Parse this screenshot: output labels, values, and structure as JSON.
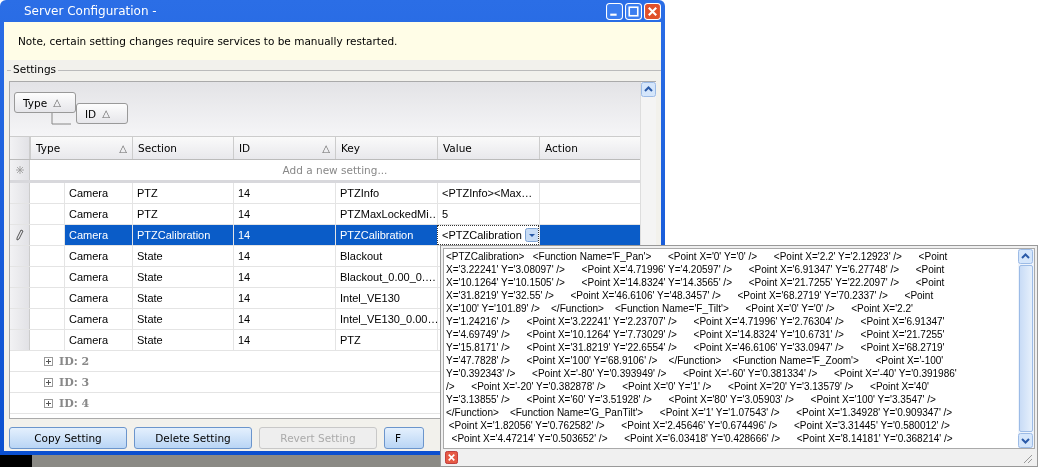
{
  "window": {
    "title": "Server Configuration -"
  },
  "note": "Note, certain setting changes require services to be manually restarted.",
  "settings": {
    "title": "Settings",
    "group_by": [
      {
        "label": "Type",
        "sort": "△"
      },
      {
        "label": "ID",
        "sort": "△"
      }
    ],
    "columns": [
      {
        "label": "Type",
        "sort": "△"
      },
      {
        "label": "Section"
      },
      {
        "label": "ID",
        "sort": "△"
      },
      {
        "label": "Key"
      },
      {
        "label": "Value"
      },
      {
        "label": "Action"
      }
    ],
    "new_row_placeholder": "Add a new setting...",
    "rows": [
      {
        "type": "Camera",
        "section": "PTZ",
        "id": "14",
        "key": "PTZInfo",
        "value": "<PTZInfo><Max…",
        "selected": false,
        "editing": false
      },
      {
        "type": "Camera",
        "section": "PTZ",
        "id": "14",
        "key": "PTZMaxLockedMi…",
        "value": "5",
        "selected": false,
        "editing": false
      },
      {
        "type": "Camera",
        "section": "PTZCalibration",
        "id": "14",
        "key": "PTZCalibration",
        "value": "<PTZCalibration",
        "selected": true,
        "editing": true
      },
      {
        "type": "Camera",
        "section": "State",
        "id": "14",
        "key": "Blackout",
        "selected": false,
        "editing": false
      },
      {
        "type": "Camera",
        "section": "State",
        "id": "14",
        "key": "Blackout_0.00_0.…",
        "selected": false,
        "editing": false
      },
      {
        "type": "Camera",
        "section": "State",
        "id": "14",
        "key": "Intel_VE130",
        "selected": false,
        "editing": false
      },
      {
        "type": "Camera",
        "section": "State",
        "id": "14",
        "key": "Intel_VE130_0.00…",
        "selected": false,
        "editing": false
      },
      {
        "type": "Camera",
        "section": "State",
        "id": "14",
        "key": "PTZ",
        "selected": false,
        "editing": false
      }
    ],
    "groups": [
      {
        "label": "ID: 2",
        "expanded": false
      },
      {
        "label": "ID: 3",
        "expanded": false
      },
      {
        "label": "ID: 4",
        "expanded": false
      }
    ]
  },
  "buttons": [
    {
      "label": "Copy Setting",
      "disabled": false
    },
    {
      "label": "Delete Setting",
      "disabled": false
    },
    {
      "label": "Revert Setting",
      "disabled": true
    },
    {
      "label": "F",
      "disabled": false
    }
  ],
  "value_editor": {
    "lines": [
      "<PTZCalibration>   <Function Name='F_Pan'>      <Point X='0' Y='0' />      <Point X='2.2' Y='2.12923' />      <Point",
      "X='3.22241' Y='3.08097' />      <Point X='4.71996' Y='4.20597' />      <Point X='6.91347' Y='6.27748' />      <Point",
      "X='10.1264' Y='10.1505' />      <Point X='14.8324' Y='14.3565' />      <Point X='21.7255' Y='22.2097' />      <Point",
      "X='31.8219' Y='32.55' />      <Point X='46.6106' Y='48.3457' />      <Point X='68.2719' Y='70.2337' />      <Point",
      "X='100' Y='101.89' />    </Function>    <Function Name='F_Tilt'>      <Point X='0' Y='0' />      <Point X='2.2'",
      "Y='1.24216' />      <Point X='3.22241' Y='2.23707' />      <Point X='4.71996' Y='2.76304' />      <Point X='6.91347'",
      "Y='4.69749' />      <Point X='10.1264' Y='7.73029' />      <Point X='14.8324' Y='10.6731' />      <Point X='21.7255'",
      "Y='15.8171' />      <Point X='31.8219' Y='22.6554' />      <Point X='46.6106' Y='33.0947' />      <Point X='68.2719'",
      "Y='47.7828' />      <Point X='100' Y='68.9106' />    </Function>    <Function Name='F_Zoom'>      <Point X='-100'",
      "Y='0.392343' />      <Point X='-80' Y='0.393949' />      <Point X='-60' Y='0.381334' />      <Point X='-40' Y='0.391986'",
      "/>      <Point X='-20' Y='0.382878' />      <Point X='0' Y='1' />      <Point X='20' Y='3.13579' />      <Point X='40'",
      "Y='3.13855' />      <Point X='60' Y='3.51928' />      <Point X='80' Y='3.05903' />      <Point X='100' Y='3.3547' />",
      "</Function>    <Function Name='G_PanTilt'>      <Point X='1' Y='1.07543' />      <Point X='1.34928' Y='0.909347' />",
      " <Point X='1.82056' Y='0.762582' />      <Point X='2.45646' Y='0.674496' />      <Point X='3.31445' Y='0.580012' />",
      "  <Point X='4.47214' Y='0.503652' />      <Point X='6.03418' Y='0.428666' />      <Point X='8.14181' Y='0.368214' />"
    ]
  }
}
